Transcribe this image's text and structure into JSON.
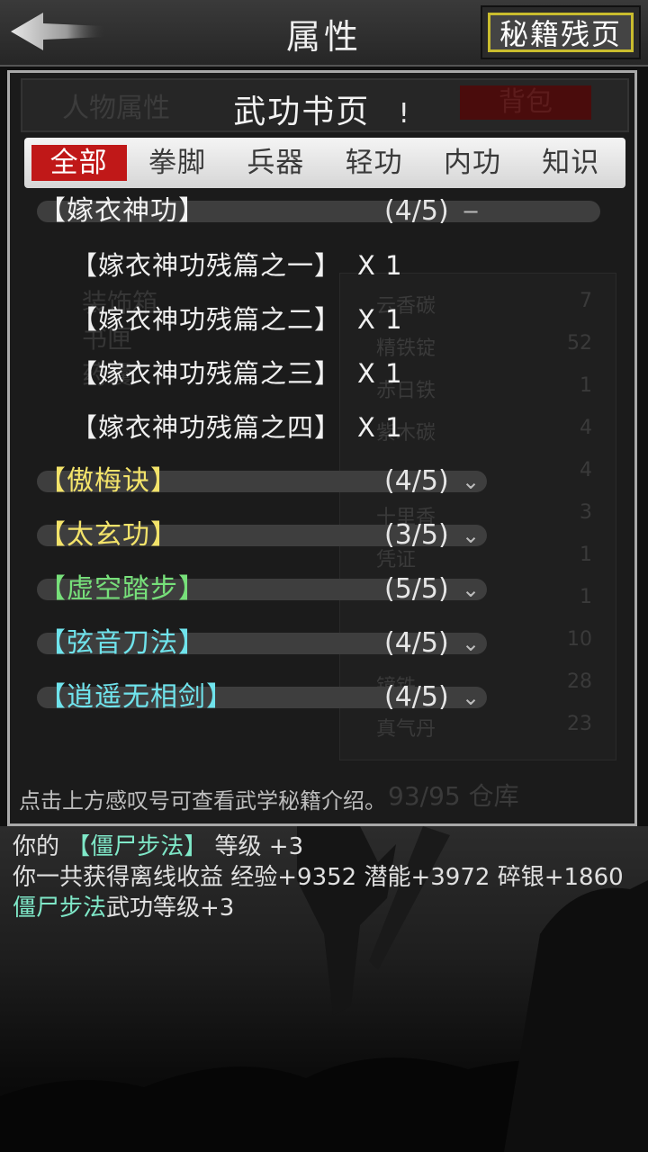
{
  "header": {
    "title": "属性",
    "manual_button": "秘籍残页"
  },
  "panel": {
    "ghost_left_tab": "人物属性",
    "ghost_bag": "背包",
    "title": "武功书页",
    "info_mark": "!",
    "ghost_items_left": [
      "装饰箱",
      "书匣",
      "药囊"
    ],
    "ghost_items_right": [
      {
        "name": "云香碳",
        "count": "7"
      },
      {
        "name": "精铁锭",
        "count": "52"
      },
      {
        "name": "赤日铁",
        "count": "1"
      },
      {
        "name": "紫木碳",
        "count": "4"
      },
      {
        "name": "",
        "count": "4"
      },
      {
        "name": "十里香",
        "count": "3"
      },
      {
        "name": "凭证",
        "count": "1"
      },
      {
        "name": "",
        "count": "1"
      },
      {
        "name": "",
        "count": "10"
      },
      {
        "name": "镜铁",
        "count": "28"
      },
      {
        "name": "真气丹",
        "count": "23"
      }
    ],
    "ghost_count": "93/95 仓库",
    "hint": "点击上方感叹号可查看武学秘籍介绍。"
  },
  "tabs": [
    {
      "label": "全部",
      "active": true
    },
    {
      "label": "拳脚",
      "active": false
    },
    {
      "label": "兵器",
      "active": false
    },
    {
      "label": "轻功",
      "active": false
    },
    {
      "label": "内功",
      "active": false
    },
    {
      "label": "知识",
      "active": false
    }
  ],
  "groups": [
    {
      "name": "【嫁衣神功】",
      "progress": "(4/5)",
      "toggle": "−",
      "color": "#f2f2f2",
      "expanded": true,
      "pages": [
        {
          "name": "【嫁衣神功残篇之一】",
          "qty": "X 1"
        },
        {
          "name": "【嫁衣神功残篇之二】",
          "qty": "X 1"
        },
        {
          "name": "【嫁衣神功残篇之三】",
          "qty": "X 1"
        },
        {
          "name": "【嫁衣神功残篇之四】",
          "qty": "X 1"
        }
      ]
    },
    {
      "name": "【傲梅诀】",
      "progress": "(4/5)",
      "toggle": "⌄",
      "color": "#f3e36a",
      "expanded": false,
      "pages": []
    },
    {
      "name": "【太玄功】",
      "progress": "(3/5)",
      "toggle": "⌄",
      "color": "#f3e36a",
      "expanded": false,
      "pages": []
    },
    {
      "name": "【虚空踏步】",
      "progress": "(5/5)",
      "toggle": "⌄",
      "color": "#77e07a",
      "expanded": false,
      "pages": []
    },
    {
      "name": "【弦音刀法】",
      "progress": "(4/5)",
      "toggle": "⌄",
      "color": "#6fe3ec",
      "expanded": false,
      "pages": []
    },
    {
      "name": "【逍遥无相剑】",
      "progress": "(4/5)",
      "toggle": "⌄",
      "color": "#6fe3ec",
      "expanded": false,
      "pages": []
    }
  ],
  "log": {
    "line1_prefix": "你的 ",
    "line1_skill": "【僵尸步法】",
    "line1_suffix": " 等级 +3",
    "line2_prefix": "你一共获得离线收益 经验+9352 潜能+3972 碎银+1860 ",
    "line2_skill": "僵尸步法",
    "line2_suffix": "武功等级+3"
  }
}
